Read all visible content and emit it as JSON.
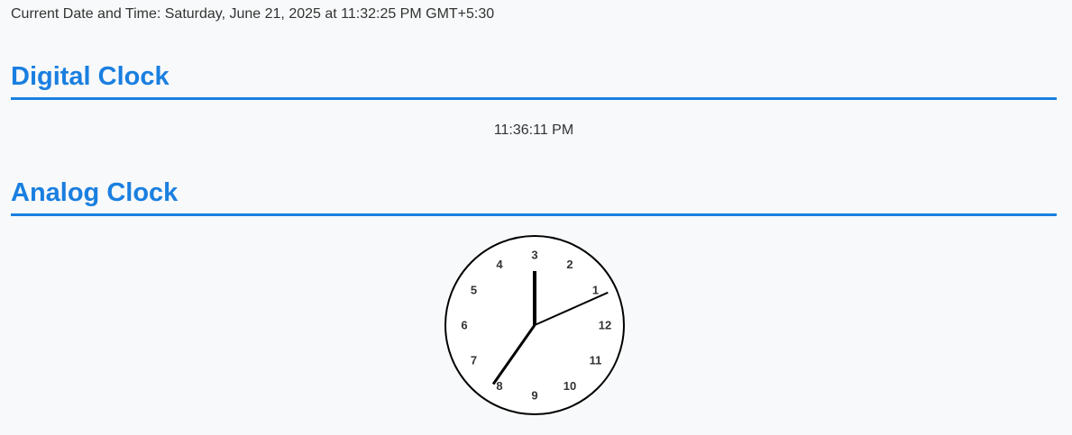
{
  "header": {
    "datetime_text": "Current Date and Time: Saturday, June 21, 2025 at 11:32:25 PM GMT+5:30"
  },
  "digital": {
    "title": "Digital Clock",
    "time": "11:36:11 PM"
  },
  "analog": {
    "title": "Analog Clock",
    "numbers": [
      "1",
      "2",
      "3",
      "4",
      "5",
      "6",
      "7",
      "8",
      "9",
      "10",
      "11",
      "12"
    ],
    "hands": {
      "hour_deg": 348,
      "minute_deg": 215,
      "second_deg": 66
    }
  },
  "colors": {
    "accent": "#1a7fe0",
    "text": "#333333",
    "background": "#f8f9fa"
  }
}
